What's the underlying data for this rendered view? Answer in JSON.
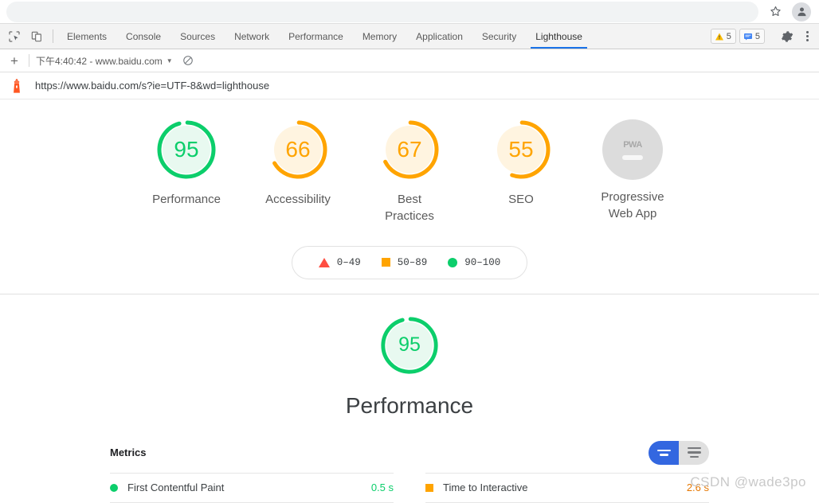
{
  "browser": {
    "bookmark_icon": "star-icon",
    "profile_icon": "avatar-icon"
  },
  "devtools": {
    "inspect_icon": "inspect-element-icon",
    "device_toolbar_icon": "device-toolbar-icon",
    "tabs": [
      {
        "label": "Elements",
        "active": false
      },
      {
        "label": "Console",
        "active": false
      },
      {
        "label": "Sources",
        "active": false
      },
      {
        "label": "Network",
        "active": false
      },
      {
        "label": "Performance",
        "active": false
      },
      {
        "label": "Memory",
        "active": false
      },
      {
        "label": "Application",
        "active": false
      },
      {
        "label": "Security",
        "active": false
      },
      {
        "label": "Lighthouse",
        "active": true
      }
    ],
    "warning_badge": {
      "icon": "warning-triangle-icon",
      "count": "5"
    },
    "message_badge": {
      "icon": "message-icon",
      "count": "5"
    },
    "settings_icon": "gear-icon",
    "more_icon": "kebab-menu-icon"
  },
  "lighthouse_toolbar": {
    "add_label": "+",
    "run_label": "下午4:40:42 - www.baidu.com",
    "caret": "▼",
    "clear_icon": "clear-all-icon"
  },
  "url_row": {
    "logo_icon": "lighthouse-logo-icon",
    "url": "https://www.baidu.com/s?ie=UTF-8&wd=lighthouse"
  },
  "scores": {
    "gauges": [
      {
        "score": "95",
        "label": "Performance",
        "color": "#0cce6b",
        "fill": "#e8f9f0",
        "percent": 95,
        "type": "arc"
      },
      {
        "score": "66",
        "label": "Accessibility",
        "color": "#ffa400",
        "fill": "#fff4e0",
        "percent": 66,
        "type": "arc"
      },
      {
        "score": "67",
        "label": "Best Practices",
        "color": "#ffa400",
        "fill": "#fff4e0",
        "percent": 67,
        "type": "arc"
      },
      {
        "score": "55",
        "label": "SEO",
        "color": "#ffa400",
        "fill": "#fff4e0",
        "percent": 55,
        "type": "arc"
      },
      {
        "score": "PWA",
        "label": "Progressive Web App",
        "color": "#a8a8a8",
        "fill": "#dcdcdc",
        "percent": 0,
        "type": "pwa"
      }
    ],
    "legend": [
      {
        "shape": "triangle",
        "range": "0–49",
        "color": "#ff4e42"
      },
      {
        "shape": "square",
        "range": "50–89",
        "color": "#ffa400"
      },
      {
        "shape": "circle",
        "range": "90–100",
        "color": "#0cce6b"
      }
    ]
  },
  "performance_section": {
    "score": "95",
    "title": "Performance",
    "color": "#0cce6b",
    "percent": 95
  },
  "metrics": {
    "title": "Metrics",
    "toggle": {
      "active_view": "simple-view",
      "inactive_view": "detail-view"
    },
    "items": [
      {
        "name": "First Contentful Paint",
        "value": "0.5 s",
        "marker": "dot",
        "color": "#0cce6b"
      },
      {
        "name": "Time to Interactive",
        "value": "2.6 s",
        "marker": "square",
        "color": "#e67700"
      }
    ]
  },
  "watermark": "CSDN @wade3po"
}
